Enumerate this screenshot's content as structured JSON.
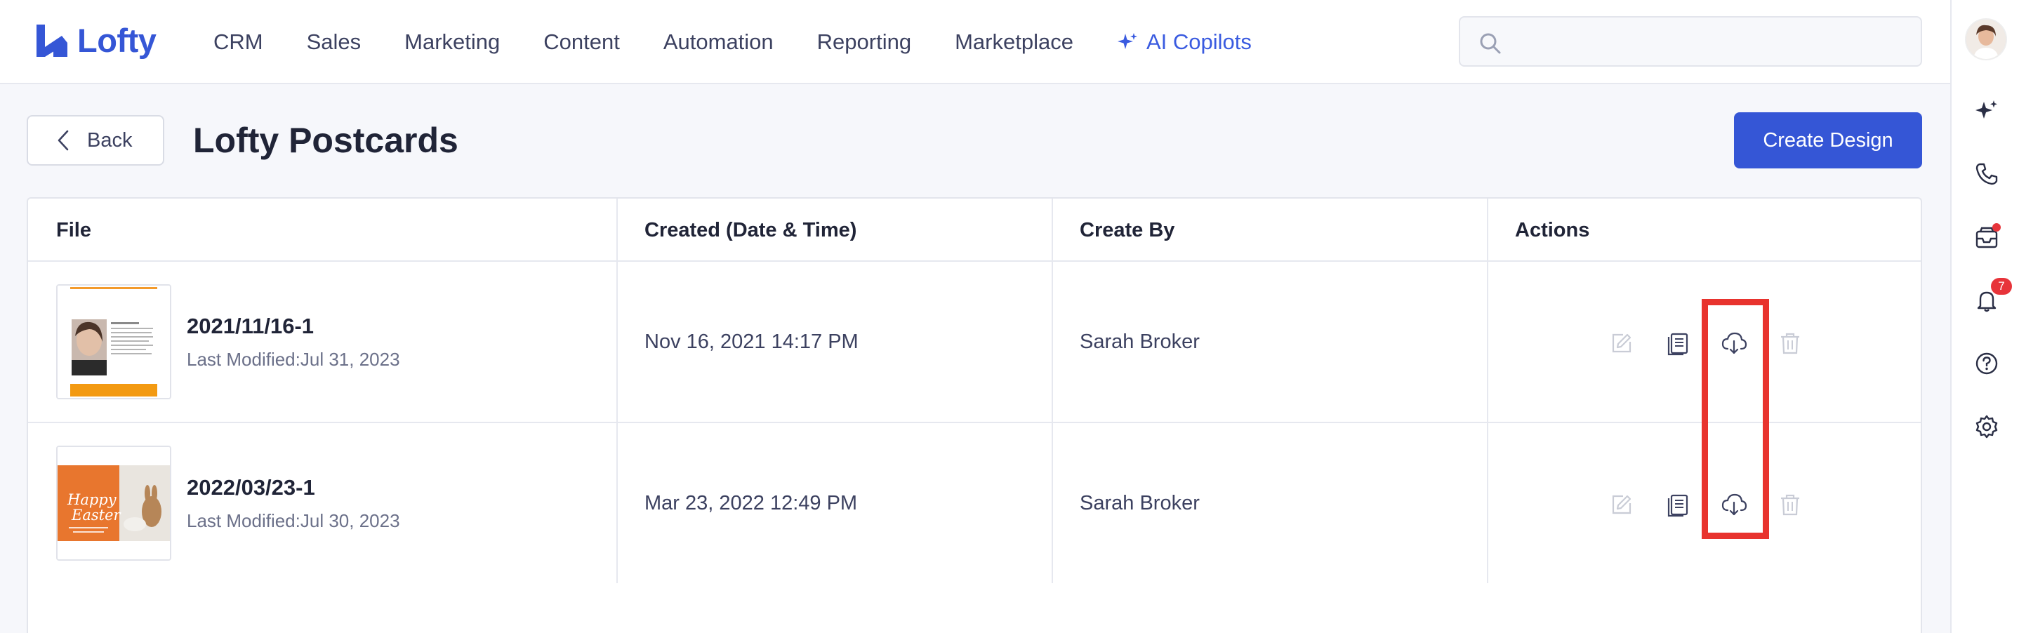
{
  "app": {
    "name": "Lofty",
    "brand_color": "#3556d6"
  },
  "nav": {
    "items": [
      "CRM",
      "Sales",
      "Marketing",
      "Content",
      "Automation",
      "Reporting",
      "Marketplace"
    ],
    "ai_label": "AI Copilots"
  },
  "search": {
    "placeholder": "",
    "icon": "search-icon"
  },
  "rail": {
    "icons": [
      "avatar",
      "sparkle-icon",
      "phone-icon",
      "inbox-icon",
      "bell-icon",
      "help-icon",
      "gear-icon"
    ],
    "notification_count": "7"
  },
  "page": {
    "back_label": "Back",
    "title": "Lofty Postcards",
    "create_label": "Create Design"
  },
  "table": {
    "columns": [
      "File",
      "Created (Date & Time)",
      "Create By",
      "Actions"
    ],
    "rows": [
      {
        "name": "2021/11/16-1",
        "modified": "Last Modified:Jul 31, 2023",
        "created": "Nov 16, 2021 14:17 PM",
        "by": "Sarah Broker"
      },
      {
        "name": "2022/03/23-1",
        "modified": "Last Modified:Jul 30, 2023",
        "created": "Mar 23, 2022 12:49 PM",
        "by": "Sarah Broker"
      }
    ],
    "actions": [
      "edit-icon",
      "copy-icon",
      "download-icon",
      "delete-icon"
    ]
  },
  "thumb2_text": {
    "line1": "Happy",
    "line2": "Easter"
  },
  "colors": {
    "highlight": "#e8332e",
    "accent": "#3556d6",
    "ai": "#3a5be0"
  }
}
